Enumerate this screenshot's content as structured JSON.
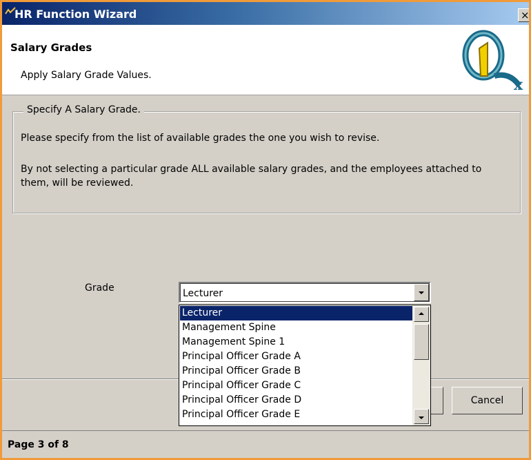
{
  "window": {
    "title": "HR Function Wizard",
    "close_glyph": "×"
  },
  "header": {
    "title": "Salary Grades",
    "subtitle": "Apply Salary Grade Values.",
    "logo_icon": "q-logo-icon"
  },
  "group": {
    "legend": "Specify A Salary Grade.",
    "paragraph1": "Please specify from the list of available grades the one you wish to revise.",
    "paragraph2": "By not selecting a particular grade ALL available salary grades, and the employees attached to them, will be reviewed."
  },
  "grade": {
    "label": "Grade",
    "selected": "Lecturer",
    "options": [
      "Lecturer",
      "Management Spine",
      "Management Spine 1",
      "Principal Officer Grade A",
      "Principal Officer Grade B",
      "Principal Officer Grade C",
      "Principal Officer Grade D",
      "Principal Officer Grade E"
    ]
  },
  "buttons": {
    "cancel": "Cancel"
  },
  "status": {
    "page": "Page 3 of 8"
  },
  "colors": {
    "accent": "#0a246a",
    "frame": "#f09a3a"
  }
}
